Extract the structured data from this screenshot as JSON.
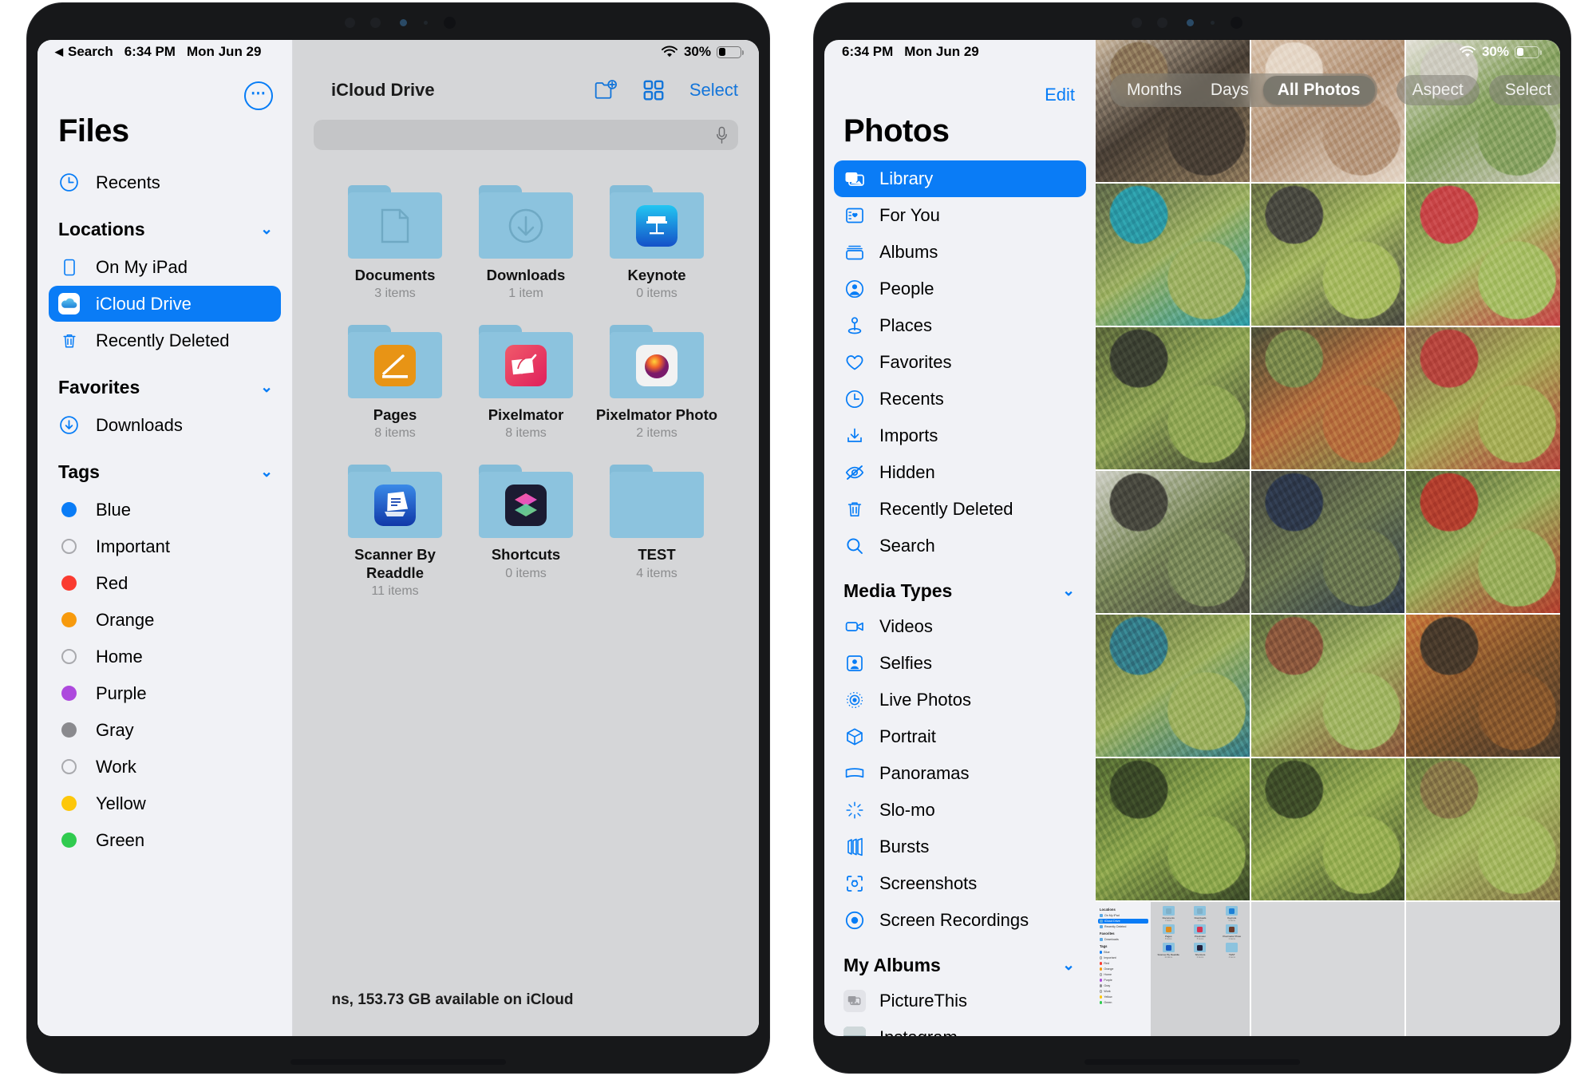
{
  "left_device": {
    "status_bar": {
      "back_label": "Search",
      "back_icon": "back-triangle-icon",
      "time": "6:34 PM",
      "date": "Mon Jun 29",
      "wifi_icon": "wifi-icon",
      "battery_percent": "30%",
      "battery_icon": "battery-icon"
    },
    "app": "Files",
    "sidebar": {
      "more_button_label": "⋯",
      "title": "Files",
      "top_items": [
        {
          "label": "Recents",
          "icon": "clock-icon"
        }
      ],
      "groups": [
        {
          "title": "Locations",
          "chevron": "⌄",
          "items": [
            {
              "label": "On My iPad",
              "icon": "ipad-icon",
              "selected": false
            },
            {
              "label": "iCloud Drive",
              "icon": "icloud-icon",
              "selected": true
            },
            {
              "label": "Recently Deleted",
              "icon": "trash-icon",
              "selected": false
            }
          ]
        },
        {
          "title": "Favorites",
          "chevron": "⌄",
          "items": [
            {
              "label": "Downloads",
              "icon": "download-circle-icon",
              "selected": false
            }
          ]
        },
        {
          "title": "Tags",
          "chevron": "⌄",
          "items": [
            {
              "label": "Blue",
              "icon": "tag-dot-icon",
              "color": "#0a7cf6",
              "hollow": false
            },
            {
              "label": "Important",
              "icon": "tag-dot-icon",
              "color": "",
              "hollow": true
            },
            {
              "label": "Red",
              "icon": "tag-dot-icon",
              "color": "#fa3b30",
              "hollow": false
            },
            {
              "label": "Orange",
              "icon": "tag-dot-icon",
              "color": "#f79a0d",
              "hollow": false
            },
            {
              "label": "Home",
              "icon": "tag-dot-icon",
              "color": "",
              "hollow": true
            },
            {
              "label": "Purple",
              "icon": "tag-dot-icon",
              "color": "#ad49dd",
              "hollow": false
            },
            {
              "label": "Gray",
              "icon": "tag-dot-icon",
              "color": "#8a8a8e",
              "hollow": false
            },
            {
              "label": "Work",
              "icon": "tag-dot-icon",
              "color": "",
              "hollow": true
            },
            {
              "label": "Yellow",
              "icon": "tag-dot-icon",
              "color": "#fdc70a",
              "hollow": false
            },
            {
              "label": "Green",
              "icon": "tag-dot-icon",
              "color": "#30cb4f",
              "hollow": false
            }
          ]
        }
      ]
    },
    "content": {
      "title": "iCloud Drive",
      "toolbar": {
        "new_folder_icon": "new-folder-icon",
        "grid_view_icon": "grid-view-icon",
        "select_label": "Select"
      },
      "search": {
        "placeholder": "",
        "value": "",
        "mic_icon": "microphone-icon"
      },
      "folders": [
        {
          "name": "Documents",
          "count": "3 items",
          "glyph": "document-icon"
        },
        {
          "name": "Downloads",
          "count": "1 item",
          "glyph": "download-icon"
        },
        {
          "name": "Keynote",
          "count": "0 items",
          "glyph": "keynote-app-icon"
        },
        {
          "name": "Pages",
          "count": "8 items",
          "glyph": "pages-app-icon"
        },
        {
          "name": "Pixelmator",
          "count": "8 items",
          "glyph": "pixelmator-app-icon"
        },
        {
          "name": "Pixelmator Photo",
          "count": "2 items",
          "glyph": "pixelmator-photo-app-icon"
        },
        {
          "name": "Scanner By Readdle",
          "count": "11 items",
          "glyph": "scanner-app-icon"
        },
        {
          "name": "Shortcuts",
          "count": "0 items",
          "glyph": "shortcuts-app-icon"
        },
        {
          "name": "TEST",
          "count": "4 items",
          "glyph": ""
        }
      ],
      "footer_status": "ns, 153.73 GB available on iCloud"
    }
  },
  "right_device": {
    "status_bar": {
      "time": "6:34 PM",
      "date": "Mon Jun 29",
      "wifi_icon": "wifi-icon",
      "battery_percent": "30%",
      "battery_icon": "battery-icon"
    },
    "app": "Photos",
    "sidebar": {
      "edit_label": "Edit",
      "title": "Photos",
      "top_items": [
        {
          "label": "Library",
          "icon": "photos-library-icon",
          "selected": true
        },
        {
          "label": "For You",
          "icon": "for-you-icon",
          "selected": false
        },
        {
          "label": "Albums",
          "icon": "albums-icon",
          "selected": false
        },
        {
          "label": "People",
          "icon": "people-icon",
          "selected": false
        },
        {
          "label": "Places",
          "icon": "places-pin-icon",
          "selected": false
        },
        {
          "label": "Favorites",
          "icon": "heart-icon",
          "selected": false
        },
        {
          "label": "Recents",
          "icon": "clock-icon",
          "selected": false
        },
        {
          "label": "Imports",
          "icon": "import-icon",
          "selected": false
        },
        {
          "label": "Hidden",
          "icon": "eye-slash-icon",
          "selected": false
        },
        {
          "label": "Recently Deleted",
          "icon": "trash-icon",
          "selected": false
        },
        {
          "label": "Search",
          "icon": "search-icon",
          "selected": false
        }
      ],
      "groups": [
        {
          "title": "Media Types",
          "chevron": "⌄",
          "items": [
            {
              "label": "Videos",
              "icon": "video-camera-icon"
            },
            {
              "label": "Selfies",
              "icon": "selfie-icon"
            },
            {
              "label": "Live Photos",
              "icon": "live-photo-icon"
            },
            {
              "label": "Portrait",
              "icon": "portrait-cube-icon"
            },
            {
              "label": "Panoramas",
              "icon": "panorama-icon"
            },
            {
              "label": "Slo-mo",
              "icon": "slo-mo-icon"
            },
            {
              "label": "Bursts",
              "icon": "bursts-icon"
            },
            {
              "label": "Screenshots",
              "icon": "screenshot-icon"
            },
            {
              "label": "Screen Recordings",
              "icon": "screen-recording-icon"
            }
          ]
        },
        {
          "title": "My Albums",
          "chevron": "⌄",
          "items": [
            {
              "label": "PictureThis",
              "icon": "album-thumbnail-icon"
            },
            {
              "label": "Instagram",
              "icon": "album-thumbnail-icon"
            }
          ]
        }
      ]
    },
    "toolbar": {
      "segments": [
        {
          "label": "Months",
          "selected": false
        },
        {
          "label": "Days",
          "selected": false
        },
        {
          "label": "All Photos",
          "selected": true
        }
      ],
      "aspect_label": "Aspect",
      "select_label": "Select",
      "more_label": "⋯"
    },
    "grid": {
      "row_count": 7,
      "column_count": 3,
      "photos": [
        {
          "alt": "cat on floor near chair",
          "c1": "#cdbba4",
          "c2": "#4a4036",
          "c3": "#8f7a5c"
        },
        {
          "alt": "tattooed arm close-up",
          "c1": "#d9c3ad",
          "c2": "#b89a80",
          "c3": "#e6d8c9"
        },
        {
          "alt": "succulent in white pot",
          "c1": "#e5e2da",
          "c2": "#8aa464",
          "c3": "#cfcdc2"
        },
        {
          "alt": "venus flytrap in teal tray",
          "c1": "#5f6a4a",
          "c2": "#9fb265",
          "c3": "#2c9ca8"
        },
        {
          "alt": "sundew plant in soil",
          "c1": "#6b7347",
          "c2": "#a8bb63",
          "c3": "#4b4b42"
        },
        {
          "alt": "pitcher plants with red pot",
          "c1": "#7a8a4c",
          "c2": "#a9bf68",
          "c3": "#c9484a"
        },
        {
          "alt": "moss and seedlings",
          "c1": "#5e6b3c",
          "c2": "#93a857",
          "c3": "#3d4233"
        },
        {
          "alt": "drosera with red tendrils",
          "c1": "#4e523a",
          "c2": "#b7713f",
          "c3": "#7d8c4e"
        },
        {
          "alt": "sarracenia in teal bowl",
          "c1": "#8a6a4c",
          "c2": "#a8b05a",
          "c3": "#b8473f"
        },
        {
          "alt": "white tag marker in pot",
          "c1": "#cfd0c6",
          "c2": "#7c8a5b",
          "c3": "#4a4a40"
        },
        {
          "alt": "blue ring in dark soil",
          "c1": "#4a4a44",
          "c2": "#6d7a52",
          "c3": "#2f3a4d"
        },
        {
          "alt": "pitcher plant with red rim",
          "c1": "#5a6b3e",
          "c2": "#9cb05e",
          "c3": "#b4402f"
        },
        {
          "alt": "potted plants on ground",
          "c1": "#6a7544",
          "c2": "#9fb262",
          "c3": "#357e8a"
        },
        {
          "alt": "young carnivorous plants",
          "c1": "#5f6c40",
          "c2": "#a3b665",
          "c3": "#8d5a3e"
        },
        {
          "alt": "orange cloth bag indoors",
          "c1": "#c77a3c",
          "c2": "#8a5a2e",
          "c3": "#4a3b2c"
        },
        {
          "alt": "fern fronds",
          "c1": "#546b33",
          "c2": "#8fa84f",
          "c3": "#3b4a28"
        },
        {
          "alt": "fern leaves close up",
          "c1": "#5b7038",
          "c2": "#9ab055",
          "c3": "#404f2a"
        },
        {
          "alt": "ferns and dry ground",
          "c1": "#6b7a3e",
          "c2": "#a6b862",
          "c3": "#8a7a4a"
        },
        {
          "alt": "Files app screenshot",
          "c1": "#d7d8da",
          "c2": "#f1f2f6",
          "c3": "#0a7cf6"
        },
        {
          "alt": "",
          "c1": "#d7d8da",
          "c2": "#d7d8da",
          "c3": "#d7d8da"
        },
        {
          "alt": "",
          "c1": "#d7d8da",
          "c2": "#d7d8da",
          "c3": "#d7d8da"
        }
      ]
    },
    "mini_screenshot": {
      "groups": [
        {
          "title": "Locations",
          "items": [
            "On My iPad",
            "iCloud Drive",
            "Recently Deleted"
          ],
          "selected_index": 1
        },
        {
          "title": "Favorites",
          "items": [
            "Downloads"
          ],
          "selected_index": -1
        },
        {
          "title": "Tags",
          "items": [
            "Blue",
            "Important",
            "Red",
            "Orange",
            "Home",
            "Purple",
            "Gray",
            "Work",
            "Yellow",
            "Green"
          ],
          "selected_index": -1
        }
      ],
      "tag_colors": [
        "#0a7cf6",
        "",
        "#fa3b30",
        "#f79a0d",
        "",
        "#ad49dd",
        "#8a8a8e",
        "",
        "#fdc70a",
        "#30cb4f"
      ],
      "folders": [
        {
          "name": "Documents",
          "count": "3 items"
        },
        {
          "name": "Downloads",
          "count": "1 item"
        },
        {
          "name": "Keynote",
          "count": "0 items"
        },
        {
          "name": "Pages",
          "count": "8 items"
        },
        {
          "name": "Pixelmator",
          "count": "8 items"
        },
        {
          "name": "Pixelmator Photo",
          "count": "2 items"
        },
        {
          "name": "Scanner By Readdle",
          "count": "11 items"
        },
        {
          "name": "Shortcuts",
          "count": "0 items"
        },
        {
          "name": "TEST",
          "count": "4 items"
        }
      ],
      "folder_glyph_colors": [
        "#7fb0c9",
        "#7fb0c9",
        "#1c7fd6",
        "#e08b1a",
        "#d8304f",
        "#6b3a2a",
        "#1558c4",
        "#241f3a",
        ""
      ]
    },
    "colors": {
      "accent": "#0a7cf6",
      "sidebar_bg": "#f1f2f6",
      "toolbar_pill": "rgba(130,128,118,.55)"
    }
  }
}
